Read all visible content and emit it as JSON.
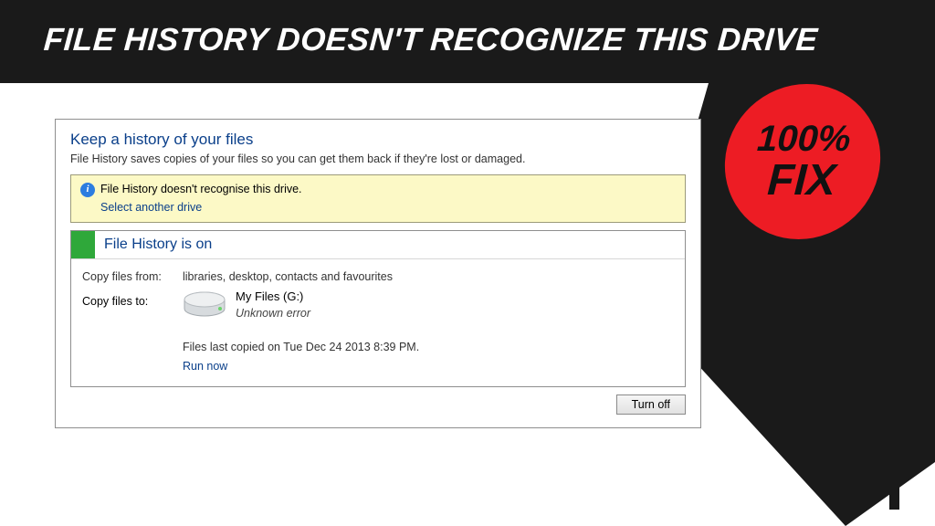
{
  "banner": {
    "headline": "FILE HISTORY DOESN'T RECOGNIZE THIS DRIVE",
    "badge_line1": "100%",
    "badge_line2": "FIX"
  },
  "dialog": {
    "title": "Keep a history of your files",
    "subtitle": "File History saves copies of your files so you can get them back if they're lost or damaged.",
    "warning": {
      "message": "File History doesn't recognise this drive.",
      "link": "Select another drive"
    },
    "status": {
      "label": "File History is on",
      "copy_from_label": "Copy files from:",
      "copy_from_value": "libraries, desktop, contacts and favourites",
      "copy_to_label": "Copy files to:",
      "drive_name": "My Files (G:)",
      "drive_error": "Unknown error",
      "last_copied": "Files last copied on Tue  Dec  24  2013 8:39 PM.",
      "run_now": "Run now"
    },
    "turn_off": "Turn off"
  }
}
